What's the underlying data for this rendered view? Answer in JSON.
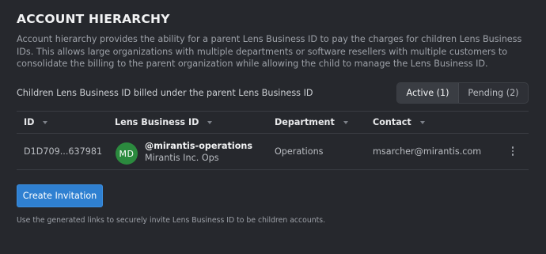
{
  "section": {
    "title": "ACCOUNT HIERARCHY",
    "description": "Account hierarchy provides the ability for a parent Lens Business ID to pay the charges for children Lens Business IDs. This allows large organizations with multiple departments or software resellers with multiple customers to consolidate the billing to the parent organization while allowing the child to manage the Lens Business ID."
  },
  "billed_label": "Children Lens Business ID billed under the parent Lens Business ID",
  "filter_tabs": [
    {
      "label": "Active (1)",
      "active": true
    },
    {
      "label": "Pending (2)",
      "active": false
    }
  ],
  "table": {
    "columns": [
      "ID",
      "Lens Business ID",
      "Department",
      "Contact"
    ],
    "rows": [
      {
        "id": "D1D709...637981",
        "avatar_initials": "MD",
        "avatar_color": "#2b8a3e",
        "lbid_handle": "@mirantis-operations",
        "lbid_org": "Mirantis Inc. Ops",
        "department": "Operations",
        "contact": "msarcher@mirantis.com",
        "menu_icon": "kebab-menu-icon"
      }
    ]
  },
  "actions": {
    "create_invitation": "Create Invitation"
  },
  "footnote": "Use the generated links to securely invite Lens Business ID to be children accounts.",
  "colors": {
    "background": "#26282d",
    "accent": "#2f80d1"
  }
}
